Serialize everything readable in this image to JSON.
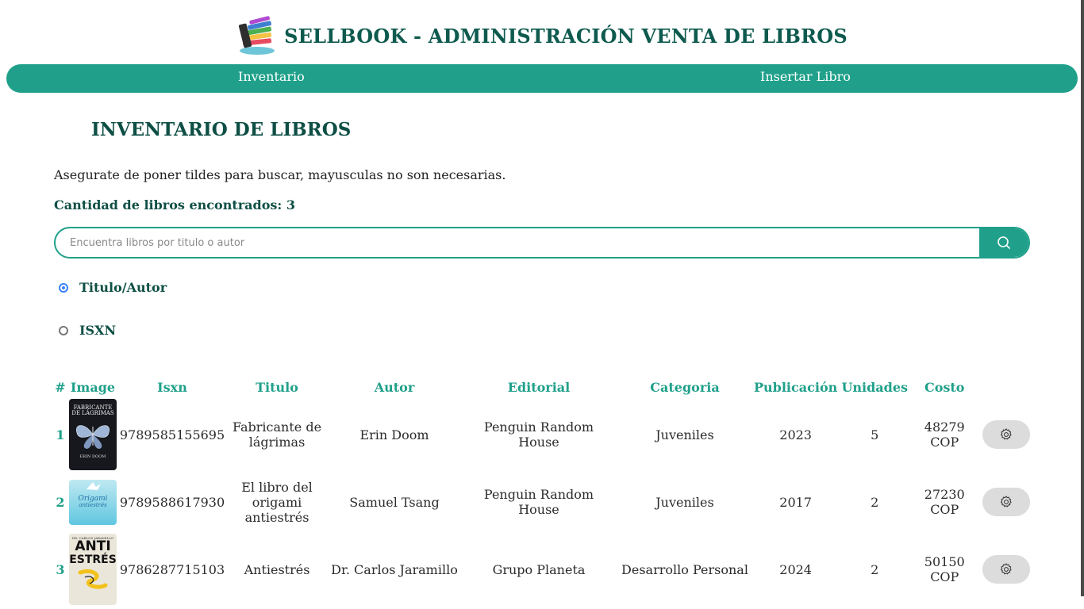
{
  "app": {
    "title": "SELLBOOK - ADMINISTRACIÓN VENTA DE LIBROS",
    "logo_icon": "books-icon"
  },
  "nav": {
    "inventory_label": "Inventario",
    "insert_label": "Insertar Libro"
  },
  "page": {
    "title": "INVENTARIO DE LIBROS",
    "hint": "Asegurate de poner tildes para buscar, mayusculas no son necesarias.",
    "count_label": "Cantidad de libros encontrados: 3"
  },
  "search": {
    "placeholder": "Encuentra libros por titulo o autor",
    "value": "",
    "button_icon": "search-icon"
  },
  "filters": [
    {
      "label": "Titulo/Autor",
      "selected": true
    },
    {
      "label": "ISXN",
      "selected": false
    }
  ],
  "table": {
    "headers": [
      "#",
      "Image",
      "Isxn",
      "Titulo",
      "Autor",
      "Editorial",
      "Categoria",
      "Publicación",
      "Unidades",
      "Costo"
    ],
    "rows": [
      {
        "num": "1",
        "cover_text": [
          "FABRICANTE",
          "DE LÁGRIMAS",
          "ERIN DOOM"
        ],
        "isxn": "9789585155695",
        "titulo": "Fabricante de lágrimas",
        "autor": "Erin Doom",
        "editorial": "Penguin Random House",
        "categoria": "Juveniles",
        "publicacion": "2023",
        "unidades": "5",
        "costo": "48279 COP",
        "action_icon": "gear-icon"
      },
      {
        "num": "2",
        "cover_text": [
          "Origami",
          "antiestrés"
        ],
        "isxn": "9789588617930",
        "titulo": "El libro del origami antiestrés",
        "autor": "Samuel Tsang",
        "editorial": "Penguin Random House",
        "categoria": "Juveniles",
        "publicacion": "2017",
        "unidades": "2",
        "costo": "27230 COP",
        "action_icon": "gear-icon"
      },
      {
        "num": "3",
        "cover_text": [
          "DR. CARLOS JARAMILLO",
          "ANTI",
          "ESTRÉS"
        ],
        "isxn": "9786287715103",
        "titulo": "Antiestrés",
        "autor": "Dr. Carlos Jaramillo",
        "editorial": "Grupo Planeta",
        "categoria": "Desarrollo Personal",
        "publicacion": "2024",
        "unidades": "2",
        "costo": "50150 COP",
        "action_icon": "gear-icon"
      }
    ]
  },
  "colors": {
    "primary": "#20a08a",
    "heading": "#0e4f45",
    "action_button": "#dcdcdc"
  }
}
